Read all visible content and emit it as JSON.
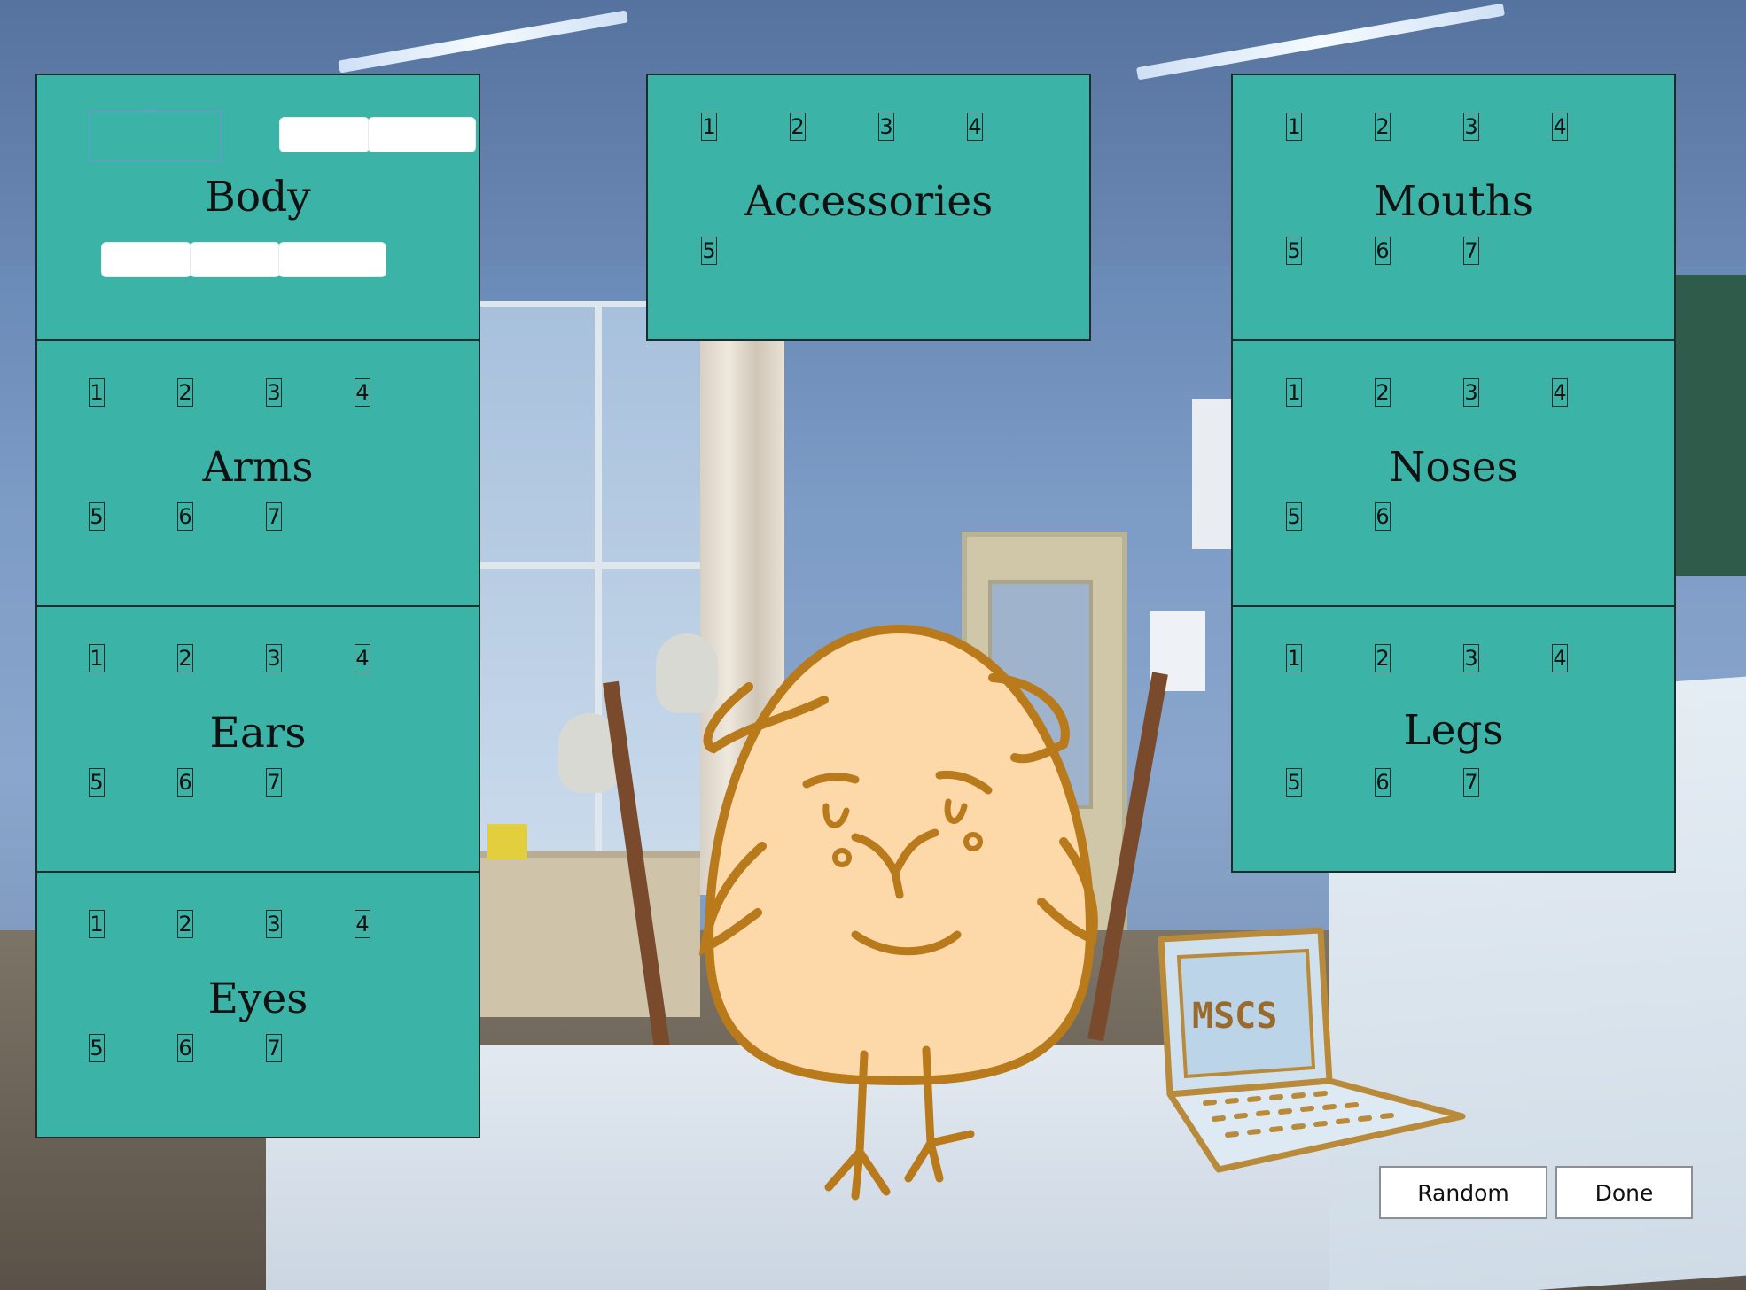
{
  "panels": {
    "body": {
      "title": "Body"
    },
    "accessories": {
      "title": "Accessories",
      "options": [
        "1",
        "2",
        "3",
        "4",
        "5"
      ]
    },
    "mouths": {
      "title": "Mouths",
      "options": [
        "1",
        "2",
        "3",
        "4",
        "5",
        "6",
        "7"
      ]
    },
    "arms": {
      "title": "Arms",
      "options": [
        "1",
        "2",
        "3",
        "4",
        "5",
        "6",
        "7"
      ]
    },
    "noses": {
      "title": "Noses",
      "options": [
        "1",
        "2",
        "3",
        "4",
        "5",
        "6"
      ]
    },
    "ears": {
      "title": "Ears",
      "options": [
        "1",
        "2",
        "3",
        "4",
        "5",
        "6",
        "7"
      ]
    },
    "legs": {
      "title": "Legs",
      "options": [
        "1",
        "2",
        "3",
        "4",
        "5",
        "6",
        "7"
      ]
    },
    "eyes": {
      "title": "Eyes",
      "options": [
        "1",
        "2",
        "3",
        "4",
        "5",
        "6",
        "7"
      ]
    }
  },
  "buttons": {
    "random": "Random",
    "done": "Done"
  },
  "laptop": {
    "label": "MSCS"
  },
  "colors": {
    "panel": "#3bb4a7",
    "egg_fill": "#fdd8a8",
    "egg_stroke": "#b97a1c"
  }
}
